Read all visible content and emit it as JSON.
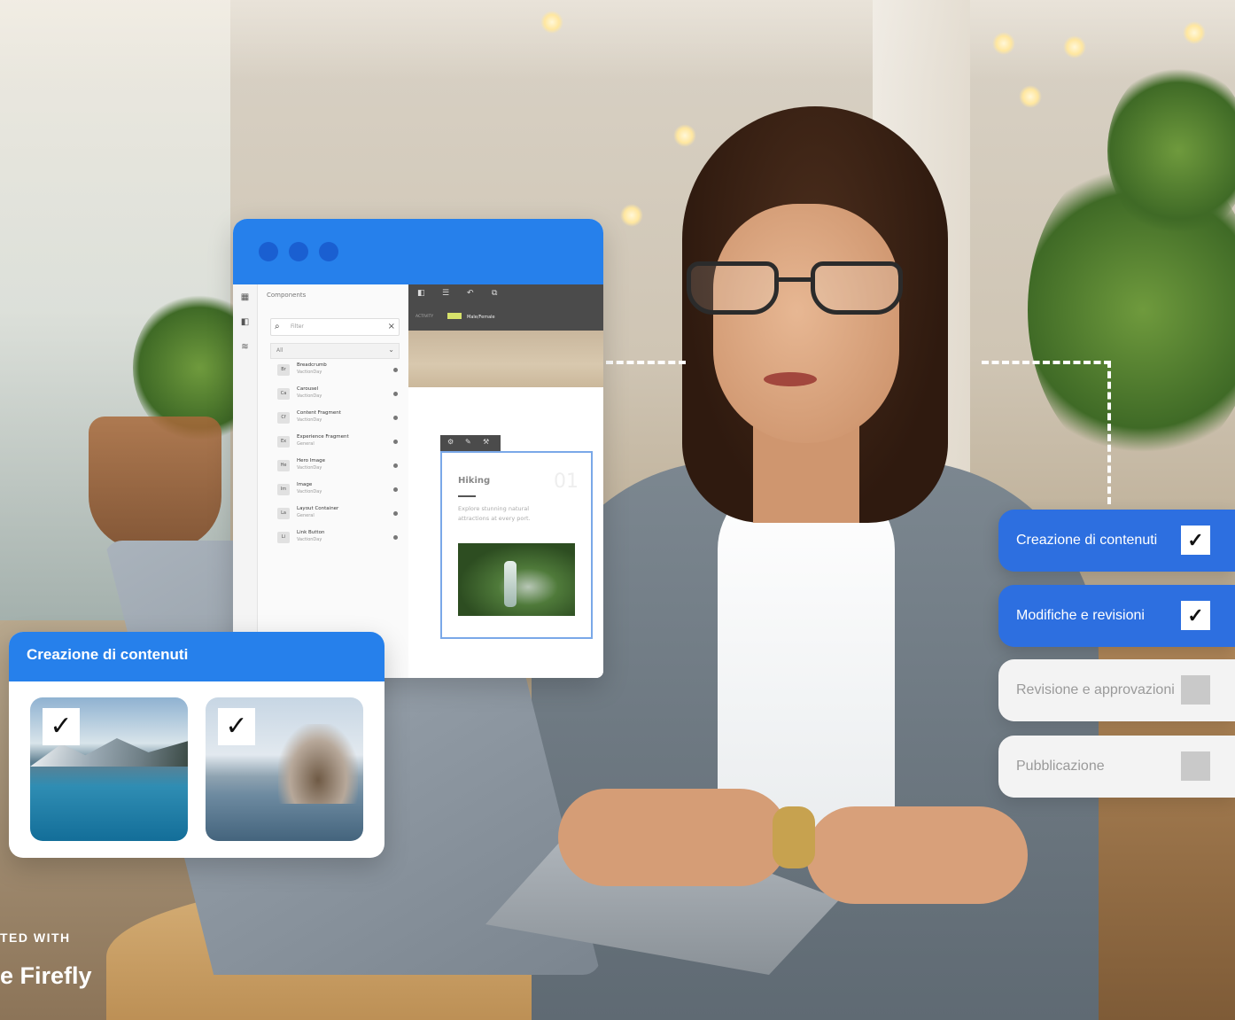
{
  "watermark": {
    "line1": "TED WITH",
    "line2": "e Firefly"
  },
  "editor": {
    "panel_title": "Components",
    "filter_placeholder": "Filter",
    "group_select": "All",
    "components": [
      {
        "abbr": "Br",
        "name": "Breadcrumb",
        "group": "VactionDay"
      },
      {
        "abbr": "Ca",
        "name": "Carousel",
        "group": "VactionDay"
      },
      {
        "abbr": "Cf",
        "name": "Content Fragment",
        "group": "VactionDay"
      },
      {
        "abbr": "Ex",
        "name": "Experience Fragment",
        "group": "General"
      },
      {
        "abbr": "He",
        "name": "Hero Image",
        "group": "VactionDay"
      },
      {
        "abbr": "Im",
        "name": "Image",
        "group": "VactionDay"
      },
      {
        "abbr": "La",
        "name": "Layout Container",
        "group": "General"
      },
      {
        "abbr": "Li",
        "name": "Link Button",
        "group": "VactionDay"
      }
    ],
    "toolbar_label": "ACTIVITY",
    "toolbar_tag": "Male/Female",
    "card": {
      "title": "Hiking",
      "number": "01",
      "description": "Explore stunning natural attractions at every port."
    }
  },
  "content_card": {
    "title": "Creazione di contenuti",
    "thumbs": [
      {
        "checked": true,
        "check_glyph": "✓"
      },
      {
        "checked": true,
        "check_glyph": "✓"
      }
    ]
  },
  "workflow": [
    {
      "label": "Creazione di contenuti",
      "checked": true,
      "check_glyph": "✓"
    },
    {
      "label": "Modifiche e revisioni",
      "checked": true,
      "check_glyph": "✓"
    },
    {
      "label": "Revisione e approvazioni",
      "checked": false
    },
    {
      "label": "Pubblicazione",
      "checked": false
    }
  ],
  "colors": {
    "accent_blue": "#2680eb",
    "step_blue": "#2d6fe0",
    "step_inactive": "#f3f3f3"
  }
}
